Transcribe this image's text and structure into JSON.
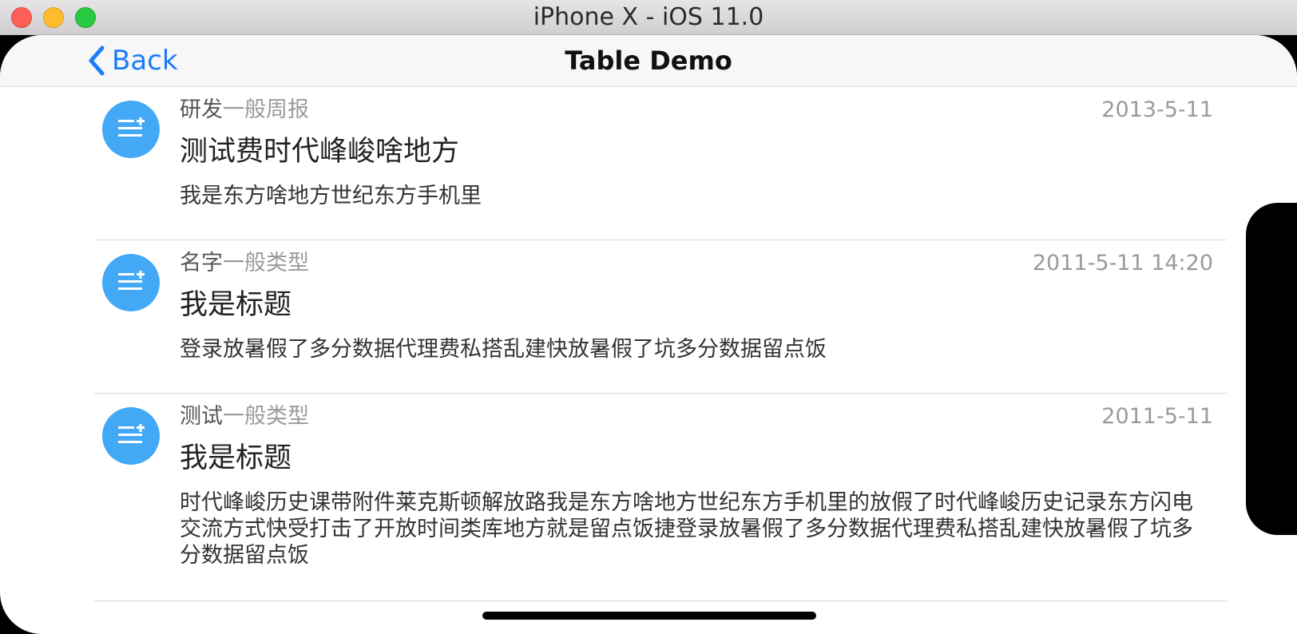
{
  "window": {
    "title": "iPhone X - iOS 11.0"
  },
  "navbar": {
    "back_label": "Back",
    "title": "Table Demo"
  },
  "rows": [
    {
      "name": "研发",
      "type": "一般周报",
      "date": "2013-5-11",
      "title": "测试费时代峰峻啥地方",
      "content": "我是东方啥地方世纪东方手机里"
    },
    {
      "name": "名字",
      "type": "一般类型",
      "date": "2011-5-11 14:20",
      "title": "我是标题",
      "content": "登录放暑假了多分数据代理费私搭乱建快放暑假了坑多分数据留点饭"
    },
    {
      "name": "测试",
      "type": "一般类型",
      "date": "2011-5-11",
      "title": "我是标题",
      "content": "时代峰峻历史课带附件莱克斯顿解放路我是东方啥地方世纪东方手机里的放假了时代峰峻历史记录东方闪电交流方式快受打击了开放时间类库地方就是留点饭捷登录放暑假了多分数据代理费私搭乱建快放暑假了坑多分数据留点饭"
    }
  ],
  "icons": {
    "back": "chevron-left-icon",
    "avatar": "list-add-icon"
  },
  "colors": {
    "accent": "#1a7cf6",
    "avatar_bg": "#43a9f7"
  }
}
